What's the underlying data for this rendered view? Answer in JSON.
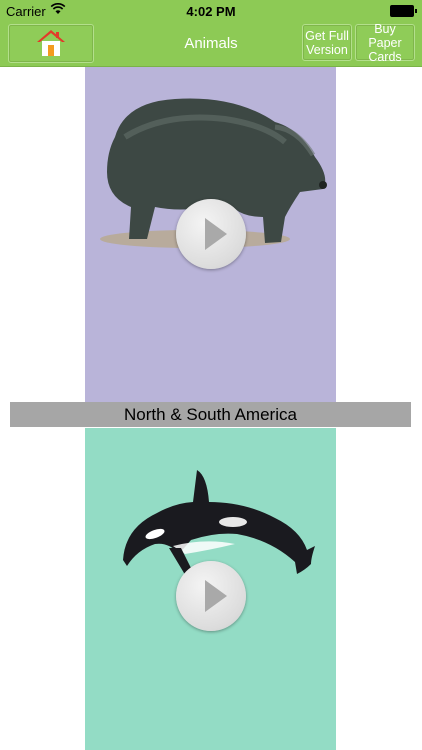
{
  "status_bar": {
    "carrier": "Carrier",
    "time": "4:02 PM"
  },
  "nav": {
    "title": "Animals",
    "home_icon": "home-icon",
    "get_full_version": "Get Full Version",
    "buy_paper_cards": "Buy Paper Cards"
  },
  "cards": [
    {
      "animal_icon": "bear-image",
      "background": "#b9b4d9"
    },
    {
      "animal_icon": "orca-image",
      "background": "#93dcc5"
    }
  ],
  "region_banner": {
    "label": "North & South America"
  },
  "colors": {
    "nav_green": "#8dca55",
    "banner_gray": "#a6a6a6"
  }
}
